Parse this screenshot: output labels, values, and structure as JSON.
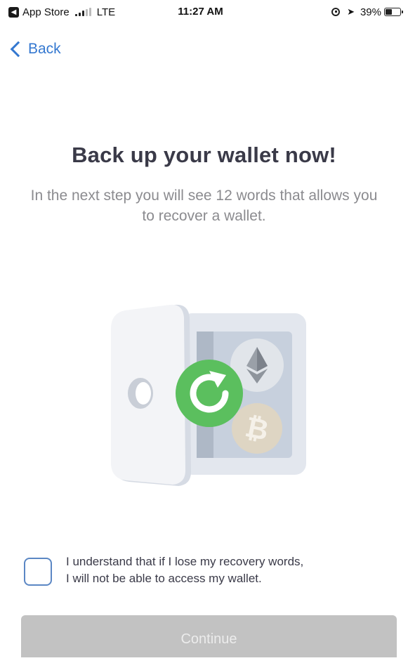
{
  "status_bar": {
    "back_app": "App Store",
    "network": "LTE",
    "time": "11:27 AM",
    "battery": "39%",
    "battery_level": 0.39,
    "icons": [
      "back-to-app-icon",
      "signal-icon",
      "orientation-lock-icon",
      "location-icon",
      "battery-icon"
    ]
  },
  "nav": {
    "back_label": "Back"
  },
  "main": {
    "title": "Back up your wallet now!",
    "subtitle": "In the next step you will see 12 words that allows you to recover a wallet.",
    "illustration": {
      "icons": [
        "vault-icon",
        "refresh-icon",
        "ethereum-coin-icon",
        "bitcoin-coin-icon"
      ]
    }
  },
  "agreement": {
    "checked": false,
    "text_line1": "I understand that if I lose my recovery words,",
    "text_line2": "I will not be able to access my wallet."
  },
  "continue_label": "Continue",
  "colors": {
    "link_blue": "#3478d0",
    "refresh_green": "#5bbf5e",
    "button_disabled": "#c2c2c2",
    "title_text": "#3a3a48",
    "subtitle_text": "#8b8b8f"
  }
}
